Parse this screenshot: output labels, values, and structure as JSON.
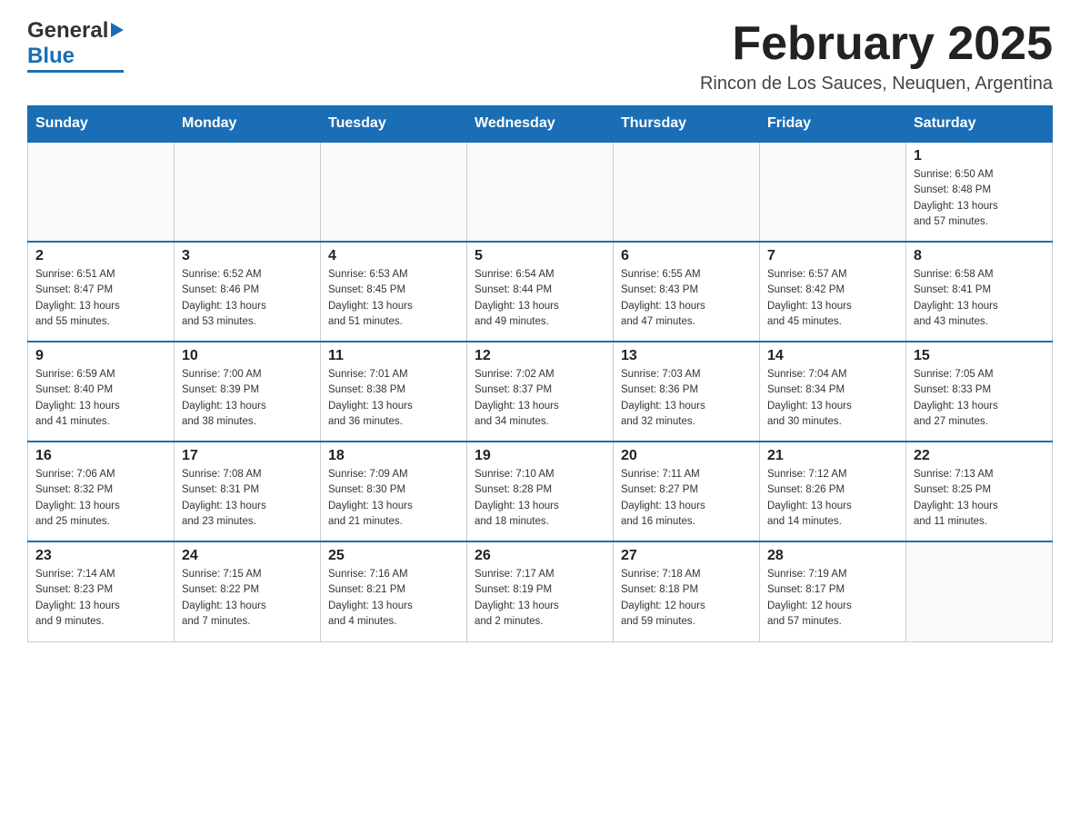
{
  "header": {
    "logo_general": "General",
    "logo_blue": "Blue",
    "month_title": "February 2025",
    "location": "Rincon de Los Sauces, Neuquen, Argentina"
  },
  "days_of_week": [
    "Sunday",
    "Monday",
    "Tuesday",
    "Wednesday",
    "Thursday",
    "Friday",
    "Saturday"
  ],
  "weeks": [
    [
      {
        "day": "",
        "info": ""
      },
      {
        "day": "",
        "info": ""
      },
      {
        "day": "",
        "info": ""
      },
      {
        "day": "",
        "info": ""
      },
      {
        "day": "",
        "info": ""
      },
      {
        "day": "",
        "info": ""
      },
      {
        "day": "1",
        "info": "Sunrise: 6:50 AM\nSunset: 8:48 PM\nDaylight: 13 hours\nand 57 minutes."
      }
    ],
    [
      {
        "day": "2",
        "info": "Sunrise: 6:51 AM\nSunset: 8:47 PM\nDaylight: 13 hours\nand 55 minutes."
      },
      {
        "day": "3",
        "info": "Sunrise: 6:52 AM\nSunset: 8:46 PM\nDaylight: 13 hours\nand 53 minutes."
      },
      {
        "day": "4",
        "info": "Sunrise: 6:53 AM\nSunset: 8:45 PM\nDaylight: 13 hours\nand 51 minutes."
      },
      {
        "day": "5",
        "info": "Sunrise: 6:54 AM\nSunset: 8:44 PM\nDaylight: 13 hours\nand 49 minutes."
      },
      {
        "day": "6",
        "info": "Sunrise: 6:55 AM\nSunset: 8:43 PM\nDaylight: 13 hours\nand 47 minutes."
      },
      {
        "day": "7",
        "info": "Sunrise: 6:57 AM\nSunset: 8:42 PM\nDaylight: 13 hours\nand 45 minutes."
      },
      {
        "day": "8",
        "info": "Sunrise: 6:58 AM\nSunset: 8:41 PM\nDaylight: 13 hours\nand 43 minutes."
      }
    ],
    [
      {
        "day": "9",
        "info": "Sunrise: 6:59 AM\nSunset: 8:40 PM\nDaylight: 13 hours\nand 41 minutes."
      },
      {
        "day": "10",
        "info": "Sunrise: 7:00 AM\nSunset: 8:39 PM\nDaylight: 13 hours\nand 38 minutes."
      },
      {
        "day": "11",
        "info": "Sunrise: 7:01 AM\nSunset: 8:38 PM\nDaylight: 13 hours\nand 36 minutes."
      },
      {
        "day": "12",
        "info": "Sunrise: 7:02 AM\nSunset: 8:37 PM\nDaylight: 13 hours\nand 34 minutes."
      },
      {
        "day": "13",
        "info": "Sunrise: 7:03 AM\nSunset: 8:36 PM\nDaylight: 13 hours\nand 32 minutes."
      },
      {
        "day": "14",
        "info": "Sunrise: 7:04 AM\nSunset: 8:34 PM\nDaylight: 13 hours\nand 30 minutes."
      },
      {
        "day": "15",
        "info": "Sunrise: 7:05 AM\nSunset: 8:33 PM\nDaylight: 13 hours\nand 27 minutes."
      }
    ],
    [
      {
        "day": "16",
        "info": "Sunrise: 7:06 AM\nSunset: 8:32 PM\nDaylight: 13 hours\nand 25 minutes."
      },
      {
        "day": "17",
        "info": "Sunrise: 7:08 AM\nSunset: 8:31 PM\nDaylight: 13 hours\nand 23 minutes."
      },
      {
        "day": "18",
        "info": "Sunrise: 7:09 AM\nSunset: 8:30 PM\nDaylight: 13 hours\nand 21 minutes."
      },
      {
        "day": "19",
        "info": "Sunrise: 7:10 AM\nSunset: 8:28 PM\nDaylight: 13 hours\nand 18 minutes."
      },
      {
        "day": "20",
        "info": "Sunrise: 7:11 AM\nSunset: 8:27 PM\nDaylight: 13 hours\nand 16 minutes."
      },
      {
        "day": "21",
        "info": "Sunrise: 7:12 AM\nSunset: 8:26 PM\nDaylight: 13 hours\nand 14 minutes."
      },
      {
        "day": "22",
        "info": "Sunrise: 7:13 AM\nSunset: 8:25 PM\nDaylight: 13 hours\nand 11 minutes."
      }
    ],
    [
      {
        "day": "23",
        "info": "Sunrise: 7:14 AM\nSunset: 8:23 PM\nDaylight: 13 hours\nand 9 minutes."
      },
      {
        "day": "24",
        "info": "Sunrise: 7:15 AM\nSunset: 8:22 PM\nDaylight: 13 hours\nand 7 minutes."
      },
      {
        "day": "25",
        "info": "Sunrise: 7:16 AM\nSunset: 8:21 PM\nDaylight: 13 hours\nand 4 minutes."
      },
      {
        "day": "26",
        "info": "Sunrise: 7:17 AM\nSunset: 8:19 PM\nDaylight: 13 hours\nand 2 minutes."
      },
      {
        "day": "27",
        "info": "Sunrise: 7:18 AM\nSunset: 8:18 PM\nDaylight: 12 hours\nand 59 minutes."
      },
      {
        "day": "28",
        "info": "Sunrise: 7:19 AM\nSunset: 8:17 PM\nDaylight: 12 hours\nand 57 minutes."
      },
      {
        "day": "",
        "info": ""
      }
    ]
  ]
}
